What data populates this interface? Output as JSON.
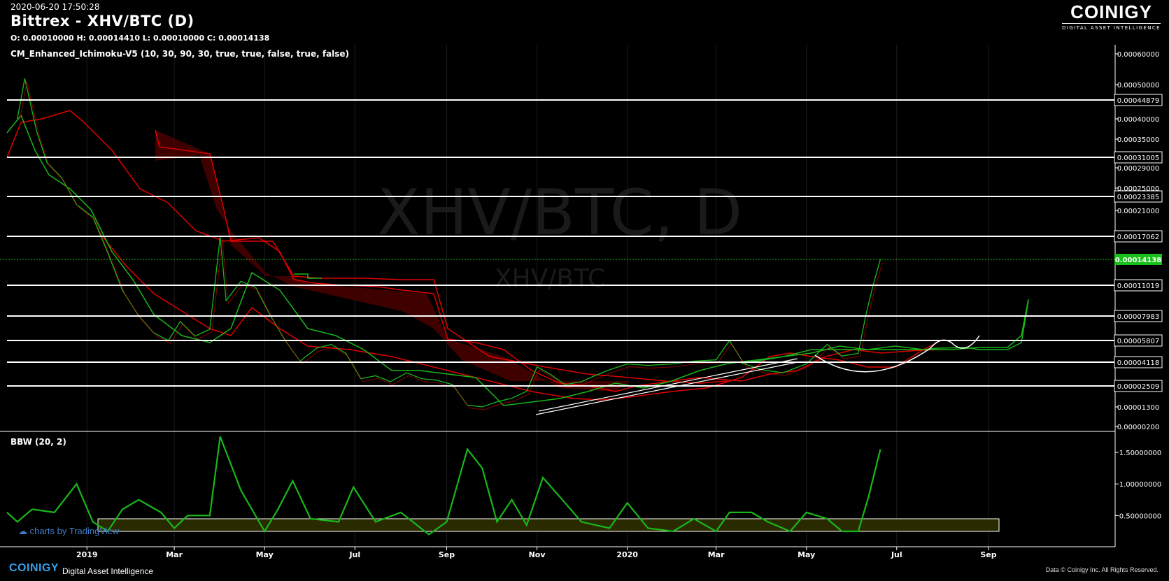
{
  "header": {
    "timestamp": "2020-06-20 17:50:28",
    "title": "Bittrex - XHV/BTC (D)",
    "ohlc": "O: 0.00010000 H: 0.00014410 L: 0.00010000 C: 0.00014138",
    "indicator_main": "CM_Enhanced_Ichimoku-V5 (10, 30, 90, 30, true, true, false, true, false)",
    "indicator_sub": "BBW (20, 2)"
  },
  "logo": {
    "word": "COINIGY",
    "sub": "DIGITAL ASSET INTELLIGENCE"
  },
  "watermark": {
    "big": "XHV/BTC, D",
    "small": "XHV/BTC",
    "tv": "charts by TradingView"
  },
  "footer": {
    "brand": "COINIGY",
    "tagline": "Digital Asset Intelligence",
    "credit": "Data © Coinigy Inc.  All Rights Reserved."
  },
  "colors": {
    "green": "#19b719",
    "red": "#e00000",
    "cloud_red": "#5a0000",
    "white": "#ffffff",
    "price_tag": "#19c019"
  },
  "chart_data": {
    "type": "line",
    "x_ticks": [
      "2019",
      "Mar",
      "May",
      "Jul",
      "Sep",
      "Nov",
      "2020",
      "Mar",
      "May",
      "Jul",
      "Sep"
    ],
    "price_axis_ticks": [
      "0.00060000",
      "0.00050000",
      "0.00040000",
      "0.00035000",
      "0.00029000",
      "0.00025000",
      "0.00021000",
      "0.00001300",
      "0.00000200"
    ],
    "horizontal_levels": [
      "0.00044879",
      "0.00031005",
      "0.00023385",
      "0.00017062",
      "0.00011019",
      "0.00007983",
      "0.00005807",
      "0.00004118",
      "0.00002509"
    ],
    "last_price": "0.00014138",
    "price_series": {
      "name": "",
      "points": [
        [
          "2018-11-15",
          0.0004
        ],
        [
          "2018-11-20",
          0.00052
        ],
        [
          "2018-11-28",
          0.00037
        ],
        [
          "2018-12-05",
          0.0003
        ],
        [
          "2018-12-15",
          0.00027
        ],
        [
          "2018-12-25",
          0.00022
        ],
        [
          "2019-01-05",
          0.0002
        ],
        [
          "2019-01-15",
          0.00015
        ],
        [
          "2019-01-25",
          0.000105
        ],
        [
          "2019-02-05",
          8e-05
        ],
        [
          "2019-02-15",
          6.5e-05
        ],
        [
          "2019-02-25",
          5.8e-05
        ],
        [
          "2019-03-05",
          7.5e-05
        ],
        [
          "2019-03-15",
          6.2e-05
        ],
        [
          "2019-03-25",
          6.8e-05
        ],
        [
          "2019-04-01",
          0.00017
        ],
        [
          "2019-04-05",
          9.5e-05
        ],
        [
          "2019-04-15",
          0.000115
        ],
        [
          "2019-04-25",
          0.000108
        ],
        [
          "2019-05-05",
          8e-05
        ],
        [
          "2019-05-15",
          5.8e-05
        ],
        [
          "2019-05-25",
          4.2e-05
        ],
        [
          "2019-06-05",
          5.2e-05
        ],
        [
          "2019-06-15",
          5.5e-05
        ],
        [
          "2019-06-25",
          4.8e-05
        ],
        [
          "2019-07-05",
          3e-05
        ],
        [
          "2019-07-15",
          3.2e-05
        ],
        [
          "2019-07-25",
          2.8e-05
        ],
        [
          "2019-08-05",
          3.4e-05
        ],
        [
          "2019-08-15",
          3e-05
        ],
        [
          "2019-08-25",
          2.9e-05
        ],
        [
          "2019-09-05",
          2.6e-05
        ],
        [
          "2019-09-15",
          1.4e-05
        ],
        [
          "2019-09-25",
          1.3e-05
        ],
        [
          "2019-10-05",
          1.6e-05
        ],
        [
          "2019-10-15",
          1.8e-05
        ],
        [
          "2019-10-25",
          2.2e-05
        ],
        [
          "2019-11-01",
          3.8e-05
        ],
        [
          "2019-11-10",
          3.3e-05
        ],
        [
          "2019-11-20",
          2.6e-05
        ],
        [
          "2019-12-01",
          2.8e-05
        ],
        [
          "2019-12-10",
          3.2e-05
        ],
        [
          "2019-12-20",
          3.6e-05
        ],
        [
          "2020-01-01",
          4e-05
        ],
        [
          "2020-01-15",
          3.9e-05
        ],
        [
          "2020-02-01",
          4e-05
        ],
        [
          "2020-02-15",
          4.2e-05
        ],
        [
          "2020-03-01",
          4.3e-05
        ],
        [
          "2020-03-10",
          5.8e-05
        ],
        [
          "2020-03-20",
          4e-05
        ],
        [
          "2020-04-01",
          3.6e-05
        ],
        [
          "2020-04-15",
          3.4e-05
        ],
        [
          "2020-05-01",
          4e-05
        ],
        [
          "2020-05-15",
          5.5e-05
        ],
        [
          "2020-05-25",
          4.6e-05
        ],
        [
          "2020-06-05",
          4.8e-05
        ],
        [
          "2020-06-10",
          8e-05
        ],
        [
          "2020-06-15",
          0.00011
        ],
        [
          "2020-06-20",
          0.00014138
        ]
      ]
    },
    "bbw_axis_ticks": [
      "1.50000000",
      "1.00000000",
      "0.50000000"
    ],
    "bbw_series": {
      "name": "",
      "points": [
        [
          "2018-11-08",
          0.55
        ],
        [
          "2018-11-15",
          0.4
        ],
        [
          "2018-11-25",
          0.6
        ],
        [
          "2018-12-10",
          0.55
        ],
        [
          "2018-12-25",
          1.0
        ],
        [
          "2019-01-05",
          0.4
        ],
        [
          "2019-01-15",
          0.25
        ],
        [
          "2019-01-25",
          0.6
        ],
        [
          "2019-02-05",
          0.75
        ],
        [
          "2019-02-20",
          0.55
        ],
        [
          "2019-03-01",
          0.3
        ],
        [
          "2019-03-10",
          0.5
        ],
        [
          "2019-03-25",
          0.5
        ],
        [
          "2019-04-01",
          1.75
        ],
        [
          "2019-04-15",
          0.9
        ],
        [
          "2019-05-01",
          0.25
        ],
        [
          "2019-05-10",
          0.6
        ],
        [
          "2019-05-20",
          1.05
        ],
        [
          "2019-06-01",
          0.45
        ],
        [
          "2019-06-20",
          0.4
        ],
        [
          "2019-06-30",
          0.95
        ],
        [
          "2019-07-15",
          0.4
        ],
        [
          "2019-08-01",
          0.55
        ],
        [
          "2019-08-20",
          0.2
        ],
        [
          "2019-09-01",
          0.4
        ],
        [
          "2019-09-15",
          1.55
        ],
        [
          "2019-09-25",
          1.25
        ],
        [
          "2019-10-05",
          0.4
        ],
        [
          "2019-10-15",
          0.75
        ],
        [
          "2019-10-25",
          0.35
        ],
        [
          "2019-11-05",
          1.1
        ],
        [
          "2019-11-20",
          0.7
        ],
        [
          "2019-12-01",
          0.4
        ],
        [
          "2019-12-20",
          0.3
        ],
        [
          "2020-01-01",
          0.7
        ],
        [
          "2020-01-15",
          0.3
        ],
        [
          "2020-02-01",
          0.25
        ],
        [
          "2020-02-15",
          0.45
        ],
        [
          "2020-03-01",
          0.25
        ],
        [
          "2020-03-10",
          0.55
        ],
        [
          "2020-03-25",
          0.55
        ],
        [
          "2020-04-05",
          0.4
        ],
        [
          "2020-04-20",
          0.25
        ],
        [
          "2020-05-01",
          0.55
        ],
        [
          "2020-05-15",
          0.45
        ],
        [
          "2020-05-25",
          0.25
        ],
        [
          "2020-06-05",
          0.25
        ],
        [
          "2020-06-12",
          0.8
        ],
        [
          "2020-06-20",
          1.55
        ]
      ]
    }
  }
}
